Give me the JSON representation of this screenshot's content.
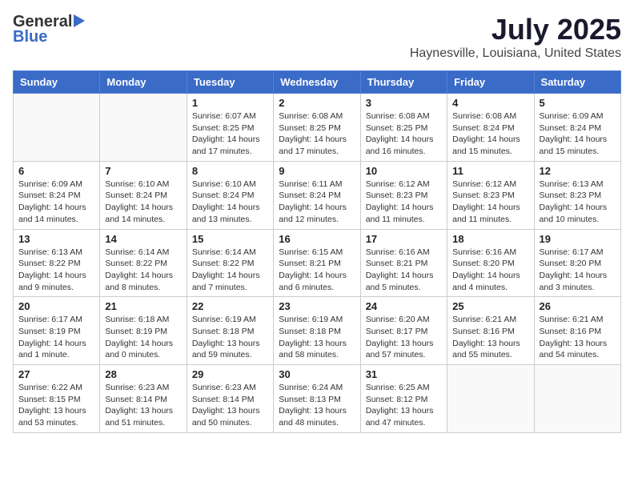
{
  "header": {
    "logo_general": "General",
    "logo_blue": "Blue",
    "month_year": "July 2025",
    "location": "Haynesville, Louisiana, United States"
  },
  "weekdays": [
    "Sunday",
    "Monday",
    "Tuesday",
    "Wednesday",
    "Thursday",
    "Friday",
    "Saturday"
  ],
  "weeks": [
    [
      {
        "day": "",
        "info": ""
      },
      {
        "day": "",
        "info": ""
      },
      {
        "day": "1",
        "info": "Sunrise: 6:07 AM\nSunset: 8:25 PM\nDaylight: 14 hours and 17 minutes."
      },
      {
        "day": "2",
        "info": "Sunrise: 6:08 AM\nSunset: 8:25 PM\nDaylight: 14 hours and 17 minutes."
      },
      {
        "day": "3",
        "info": "Sunrise: 6:08 AM\nSunset: 8:25 PM\nDaylight: 14 hours and 16 minutes."
      },
      {
        "day": "4",
        "info": "Sunrise: 6:08 AM\nSunset: 8:24 PM\nDaylight: 14 hours and 15 minutes."
      },
      {
        "day": "5",
        "info": "Sunrise: 6:09 AM\nSunset: 8:24 PM\nDaylight: 14 hours and 15 minutes."
      }
    ],
    [
      {
        "day": "6",
        "info": "Sunrise: 6:09 AM\nSunset: 8:24 PM\nDaylight: 14 hours and 14 minutes."
      },
      {
        "day": "7",
        "info": "Sunrise: 6:10 AM\nSunset: 8:24 PM\nDaylight: 14 hours and 14 minutes."
      },
      {
        "day": "8",
        "info": "Sunrise: 6:10 AM\nSunset: 8:24 PM\nDaylight: 14 hours and 13 minutes."
      },
      {
        "day": "9",
        "info": "Sunrise: 6:11 AM\nSunset: 8:24 PM\nDaylight: 14 hours and 12 minutes."
      },
      {
        "day": "10",
        "info": "Sunrise: 6:12 AM\nSunset: 8:23 PM\nDaylight: 14 hours and 11 minutes."
      },
      {
        "day": "11",
        "info": "Sunrise: 6:12 AM\nSunset: 8:23 PM\nDaylight: 14 hours and 11 minutes."
      },
      {
        "day": "12",
        "info": "Sunrise: 6:13 AM\nSunset: 8:23 PM\nDaylight: 14 hours and 10 minutes."
      }
    ],
    [
      {
        "day": "13",
        "info": "Sunrise: 6:13 AM\nSunset: 8:22 PM\nDaylight: 14 hours and 9 minutes."
      },
      {
        "day": "14",
        "info": "Sunrise: 6:14 AM\nSunset: 8:22 PM\nDaylight: 14 hours and 8 minutes."
      },
      {
        "day": "15",
        "info": "Sunrise: 6:14 AM\nSunset: 8:22 PM\nDaylight: 14 hours and 7 minutes."
      },
      {
        "day": "16",
        "info": "Sunrise: 6:15 AM\nSunset: 8:21 PM\nDaylight: 14 hours and 6 minutes."
      },
      {
        "day": "17",
        "info": "Sunrise: 6:16 AM\nSunset: 8:21 PM\nDaylight: 14 hours and 5 minutes."
      },
      {
        "day": "18",
        "info": "Sunrise: 6:16 AM\nSunset: 8:20 PM\nDaylight: 14 hours and 4 minutes."
      },
      {
        "day": "19",
        "info": "Sunrise: 6:17 AM\nSunset: 8:20 PM\nDaylight: 14 hours and 3 minutes."
      }
    ],
    [
      {
        "day": "20",
        "info": "Sunrise: 6:17 AM\nSunset: 8:19 PM\nDaylight: 14 hours and 1 minute."
      },
      {
        "day": "21",
        "info": "Sunrise: 6:18 AM\nSunset: 8:19 PM\nDaylight: 14 hours and 0 minutes."
      },
      {
        "day": "22",
        "info": "Sunrise: 6:19 AM\nSunset: 8:18 PM\nDaylight: 13 hours and 59 minutes."
      },
      {
        "day": "23",
        "info": "Sunrise: 6:19 AM\nSunset: 8:18 PM\nDaylight: 13 hours and 58 minutes."
      },
      {
        "day": "24",
        "info": "Sunrise: 6:20 AM\nSunset: 8:17 PM\nDaylight: 13 hours and 57 minutes."
      },
      {
        "day": "25",
        "info": "Sunrise: 6:21 AM\nSunset: 8:16 PM\nDaylight: 13 hours and 55 minutes."
      },
      {
        "day": "26",
        "info": "Sunrise: 6:21 AM\nSunset: 8:16 PM\nDaylight: 13 hours and 54 minutes."
      }
    ],
    [
      {
        "day": "27",
        "info": "Sunrise: 6:22 AM\nSunset: 8:15 PM\nDaylight: 13 hours and 53 minutes."
      },
      {
        "day": "28",
        "info": "Sunrise: 6:23 AM\nSunset: 8:14 PM\nDaylight: 13 hours and 51 minutes."
      },
      {
        "day": "29",
        "info": "Sunrise: 6:23 AM\nSunset: 8:14 PM\nDaylight: 13 hours and 50 minutes."
      },
      {
        "day": "30",
        "info": "Sunrise: 6:24 AM\nSunset: 8:13 PM\nDaylight: 13 hours and 48 minutes."
      },
      {
        "day": "31",
        "info": "Sunrise: 6:25 AM\nSunset: 8:12 PM\nDaylight: 13 hours and 47 minutes."
      },
      {
        "day": "",
        "info": ""
      },
      {
        "day": "",
        "info": ""
      }
    ]
  ]
}
